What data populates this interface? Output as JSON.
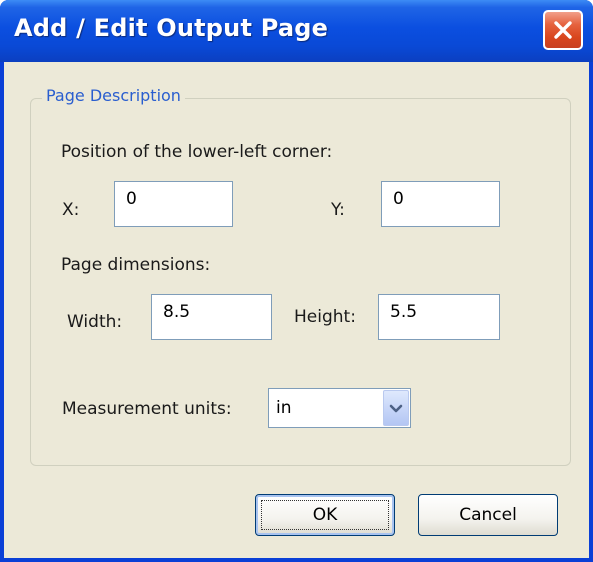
{
  "window": {
    "title": "Add / Edit Output Page"
  },
  "group": {
    "label": "Page Description"
  },
  "position": {
    "heading": "Position of the lower-left corner:",
    "x_label": "X:",
    "x_value": "0",
    "y_label": "Y:",
    "y_value": "0"
  },
  "dimensions": {
    "heading": "Page dimensions:",
    "width_label": "Width:",
    "width_value": "8.5",
    "height_label": "Height:",
    "height_value": "5.5"
  },
  "units": {
    "label": "Measurement units:",
    "selected": "in"
  },
  "buttons": {
    "ok": "OK",
    "cancel": "Cancel"
  },
  "colors": {
    "title_bar": "#0b4fe0",
    "close_button": "#d9461e",
    "dialog_background": "#ece9d8",
    "group_label": "#2a5ecf"
  },
  "icons": {
    "close": "close-icon",
    "dropdown": "chevron-down-icon"
  }
}
